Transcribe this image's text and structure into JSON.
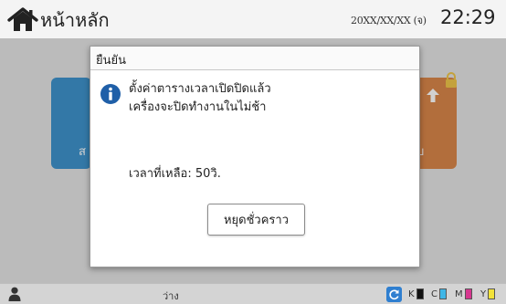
{
  "header": {
    "home_label": "หน้าหลัก",
    "date": "20XX/XX/XX (จ)",
    "time": "22:29"
  },
  "tiles": {
    "left_fragment": "ส",
    "right_fragment": "บ"
  },
  "dialog": {
    "title": "ยืนยัน",
    "message_line1": "ตั้งค่าตารางเวลาเปิดปิดแล้ว",
    "message_line2": "เครื่องจะปิดทำงานในไม่ช้า",
    "remaining": "เวลาที่เหลือ: 50วิ.",
    "pause_button": "หยุดชั่วคราว"
  },
  "statusbar": {
    "status": "ว่าง",
    "toners": [
      {
        "label": "K",
        "color": "#111111"
      },
      {
        "label": "C",
        "color": "#3fb6e6"
      },
      {
        "label": "M",
        "color": "#d6378f"
      },
      {
        "label": "Y",
        "color": "#f2e23a"
      }
    ]
  },
  "colors": {
    "accent_blue": "#2f7fd0",
    "tile_blue": "#3f93cc",
    "tile_orange": "#d9874a"
  }
}
